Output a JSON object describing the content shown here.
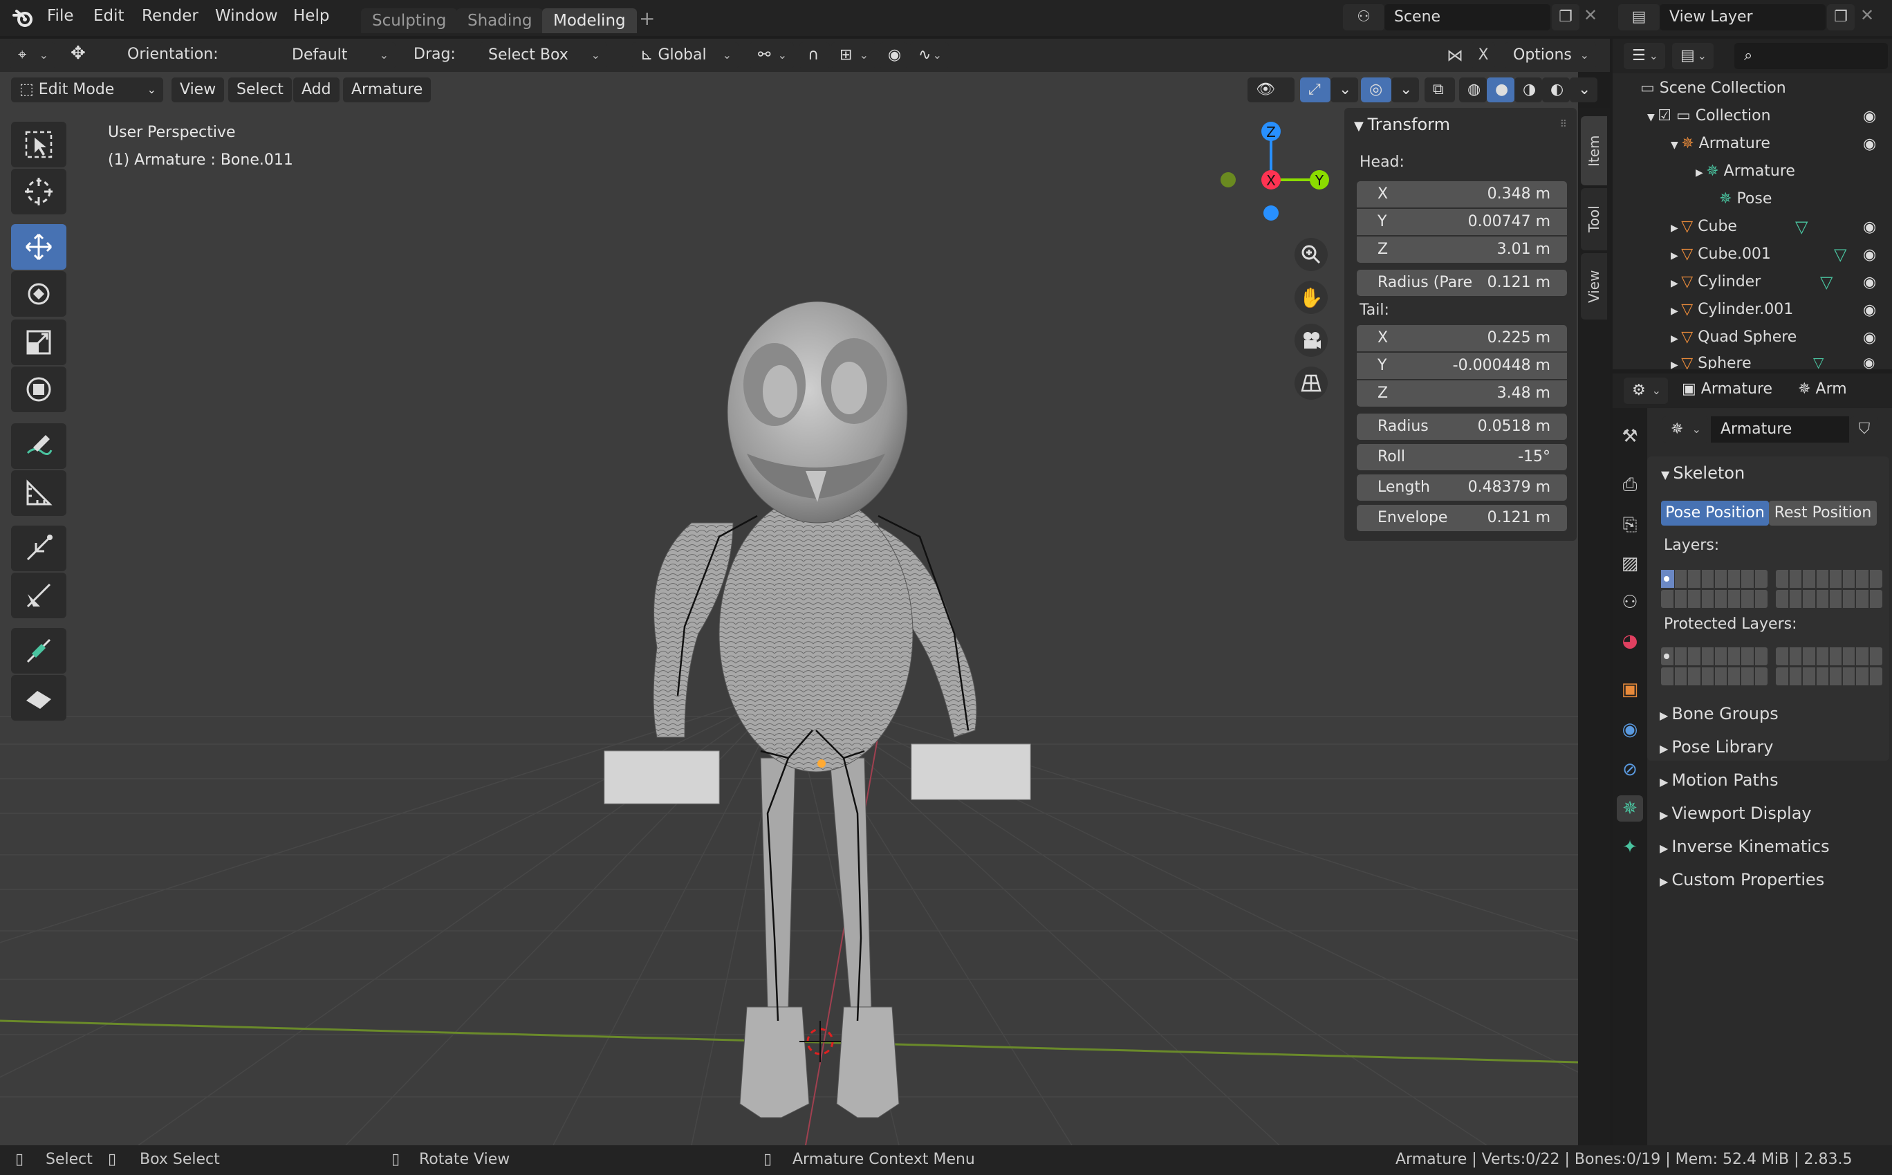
{
  "topbar": {
    "menus": [
      "File",
      "Edit",
      "Render",
      "Window",
      "Help"
    ],
    "workspaces": [
      "Sculpting",
      "Shading",
      "Modeling"
    ],
    "active_workspace": "Modeling",
    "add_tab": "+",
    "scene": "Scene",
    "view_layer": "View Layer"
  },
  "tool_header": {
    "orientation_label": "Orientation:",
    "orientation_value": "Default",
    "drag_label": "Drag:",
    "drag_value": "Select Box",
    "transform_orientation": "Global",
    "options": "Options",
    "x_label": "X"
  },
  "mode_header": {
    "mode": "Edit Mode",
    "menus": [
      "View",
      "Select",
      "Add",
      "Armature"
    ]
  },
  "viewport": {
    "perspective": "User Perspective",
    "object_info": "(1) Armature : Bone.011",
    "gizmo_axes": [
      "Z",
      "X",
      "Y"
    ]
  },
  "npanel": {
    "tabs": [
      "Item",
      "Tool",
      "View"
    ],
    "transform_title": "Transform",
    "head_label": "Head:",
    "head": [
      {
        "k": "X",
        "v": "0.348 m"
      },
      {
        "k": "Y",
        "v": "0.00747 m"
      },
      {
        "k": "Z",
        "v": "3.01 m"
      }
    ],
    "head_radius": {
      "k": "Radius (Pare",
      "v": "0.121 m"
    },
    "tail_label": "Tail:",
    "tail": [
      {
        "k": "X",
        "v": "0.225 m"
      },
      {
        "k": "Y",
        "v": "-0.000448 m"
      },
      {
        "k": "Z",
        "v": "3.48 m"
      }
    ],
    "extra": [
      {
        "k": "Radius",
        "v": "0.0518 m"
      },
      {
        "k": "Roll",
        "v": "-15°"
      },
      {
        "k": "Length",
        "v": "0.48379 m"
      },
      {
        "k": "Envelope",
        "v": "0.121 m"
      }
    ]
  },
  "outliner": {
    "scene_collection": "Scene Collection",
    "items": [
      {
        "label": "Collection"
      },
      {
        "label": "Armature"
      },
      {
        "label": "Armature"
      },
      {
        "label": "Pose"
      },
      {
        "label": "Cube"
      },
      {
        "label": "Cube.001"
      },
      {
        "label": "Cylinder"
      },
      {
        "label": "Cylinder.001"
      },
      {
        "label": "Quad Sphere"
      },
      {
        "label": "Sphere"
      }
    ]
  },
  "properties": {
    "breadcrumb_object": "Armature",
    "breadcrumb_data": "Arm",
    "datablock": "Armature",
    "skeleton_title": "Skeleton",
    "pose_position": "Pose Position",
    "rest_position": "Rest Position",
    "layers_label": "Layers:",
    "protected_layers_label": "Protected Layers:",
    "sections": [
      "Bone Groups",
      "Pose Library",
      "Motion Paths",
      "Viewport Display",
      "Inverse Kinematics",
      "Custom Properties"
    ]
  },
  "statusbar": {
    "select": "Select",
    "box_select": "Box Select",
    "rotate_view": "Rotate View",
    "context_menu": "Armature Context Menu",
    "stats": "Armature | Verts:0/22 | Bones:0/19 | Mem: 52.4 MiB | 2.83.5"
  },
  "colors": {
    "accent": "#4772b3",
    "viewport_bg": "#3d3d3d",
    "axis_x": "#ff3352",
    "axis_y": "#8bdc00",
    "axis_z": "#2890ff"
  }
}
